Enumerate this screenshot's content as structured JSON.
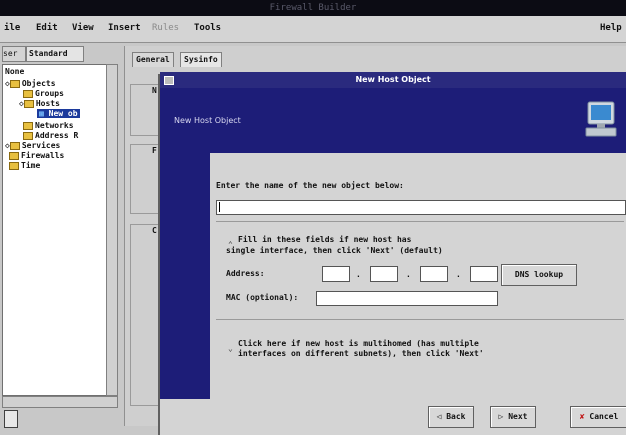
{
  "window": {
    "title": "Firewall Builder"
  },
  "menubar": [
    "ile",
    "Edit",
    "View",
    "Insert",
    "Rules",
    "Tools",
    "Help"
  ],
  "left_panel": {
    "user_button": "ser",
    "library_tab": "Standard",
    "tree": [
      {
        "label": "None"
      },
      {
        "label": "Objects"
      },
      {
        "label": "Groups"
      },
      {
        "label": "Hosts"
      },
      {
        "label": "New ob"
      },
      {
        "label": "Networks"
      },
      {
        "label": "Address R"
      },
      {
        "label": "Services"
      },
      {
        "label": "Firewalls"
      },
      {
        "label": "Time"
      }
    ]
  },
  "right_panel": {
    "tabs": [
      "General",
      "Sysinfo"
    ],
    "group_letters": [
      "N",
      "F",
      "C"
    ]
  },
  "dialog": {
    "title": "New Host Object",
    "banner_text": "New Host Object",
    "prompt": "Enter the name of the new object below:",
    "name_value": "",
    "single_option_line1": "Fill in these fields if new host has",
    "single_option_line2": "single interface, then click 'Next' (default)",
    "address_label": "Address:",
    "address_octets": [
      "",
      "",
      "",
      ""
    ],
    "address_separator": ".",
    "dns_button": "DNS lookup",
    "mac_label": "MAC (optional):",
    "mac_value": "",
    "multi_option_line1": "Click here if new host is multihomed (has multiple",
    "multi_option_line2": "interfaces on different subnets), then click 'Next'",
    "back_button": "Back",
    "next_button": "Next",
    "cancel_button": "Cancel"
  },
  "icons": [
    "folder-icon",
    "monitor-icon",
    "arrow-left-icon",
    "arrow-right-icon",
    "cancel-x-icon"
  ]
}
